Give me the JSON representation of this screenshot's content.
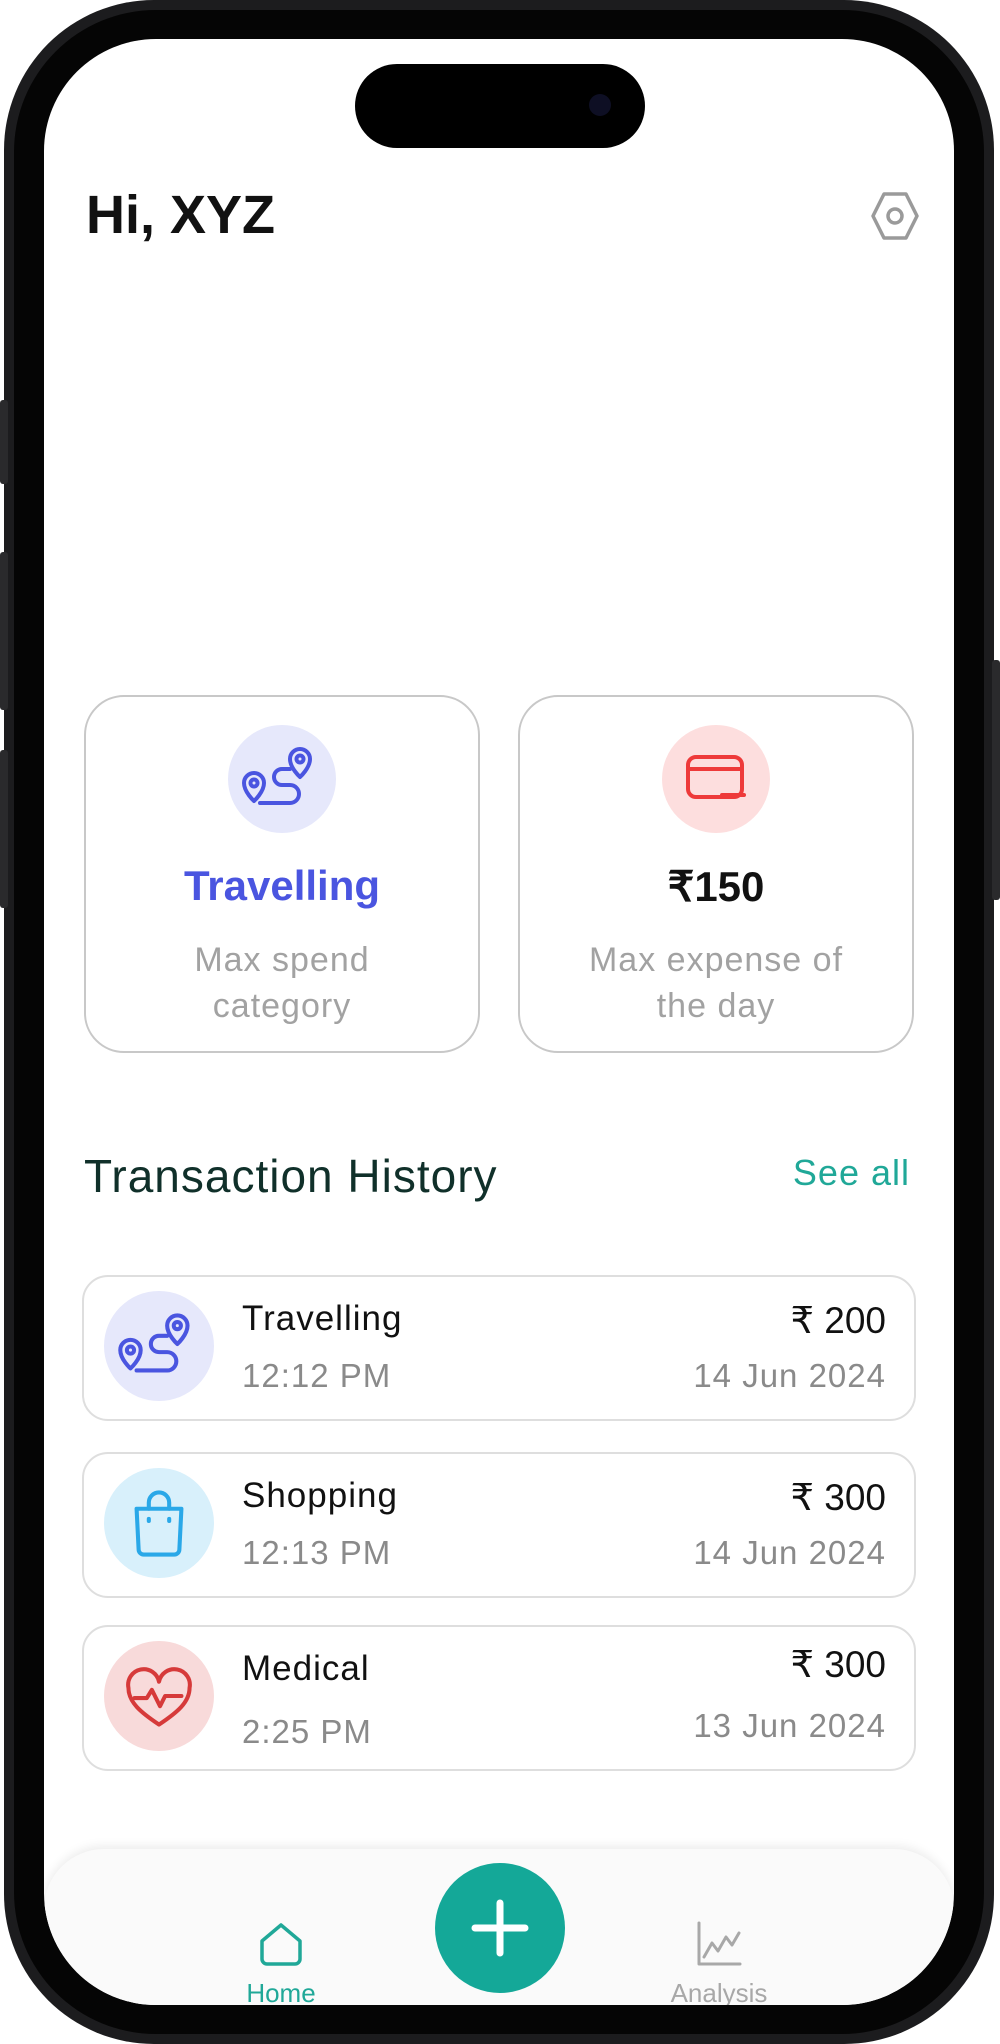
{
  "header": {
    "greeting": "Hi, XYZ"
  },
  "cards": {
    "category": {
      "value": "Travelling",
      "caption": "Max spend category",
      "accent": "#4a55e0",
      "bg": "#e6e8fb"
    },
    "expense": {
      "value": "₹150",
      "caption": "Max expense of the day",
      "accent": "#ee3a3a",
      "bg": "#fddede"
    }
  },
  "transactions": {
    "title": "Transaction History",
    "see_all": "See all",
    "items": [
      {
        "name": "Travelling",
        "time": "12:12 PM",
        "amount": "₹ 200",
        "date": "14 Jun 2024",
        "icon": "map-route-icon"
      },
      {
        "name": "Shopping",
        "time": "12:13 PM",
        "amount": "₹ 300",
        "date": "14 Jun 2024",
        "icon": "shopping-bag-icon"
      },
      {
        "name": "Medical",
        "time": "2:25 PM",
        "amount": "₹ 300",
        "date": "13 Jun 2024",
        "icon": "heart-pulse-icon"
      }
    ]
  },
  "nav": {
    "home_label": "Home",
    "analysis_label": "Analysis",
    "active_color": "#20a898",
    "inactive_color": "#a8a8a8"
  }
}
